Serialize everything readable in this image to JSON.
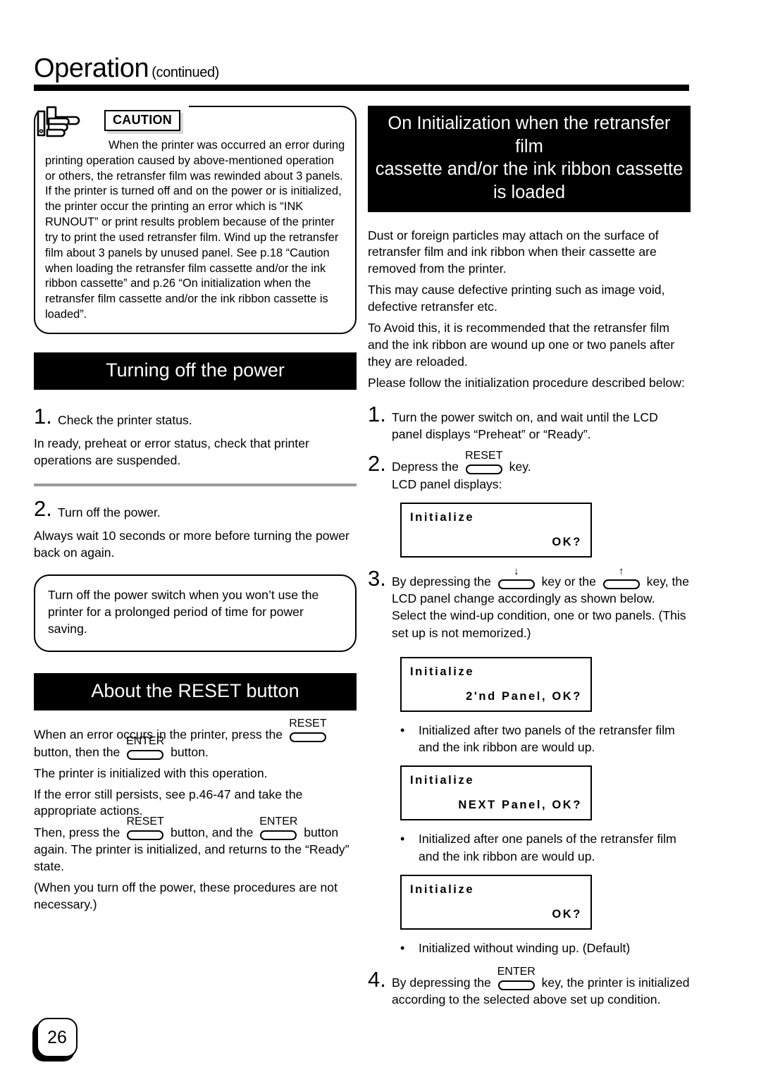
{
  "header": {
    "title": "Operation",
    "continued": "(continued)"
  },
  "caution": {
    "label": "CAUTION",
    "text": "When the printer was occurred an error during printing operation caused by above-mentioned operation or others, the retransfer film  was rewinded about 3 panels. If the printer is turned off and on the power or is initialized, the printer occur the printing an error which is “INK RUNOUT” or print results problem because of the printer try to print the used retransfer film. Wind up the retransfer film about 3 panels by unused panel. See p.18 “Caution when loading the retransfer film cassette and/or the ink ribbon cassette” and p.26 “On initialization when the retransfer film cassette and/or the ink ribbon cassette is loaded”."
  },
  "power_section": {
    "heading": "Turning off the power",
    "step1_num": "1.",
    "step1_title": "Check the printer status.",
    "step1_body": "In ready, preheat or error status, check that printer operations are suspended.",
    "step2_num": "2.",
    "step2_title": "Turn off the power.",
    "step2_body": "Always wait 10 seconds or more before turning the power back on again.",
    "note": "Turn off the power switch when you won’t use the printer for a prolonged period of time for power saving."
  },
  "reset_section": {
    "heading": "About the RESET button",
    "p1_a": "When an error occurs in the printer, press the",
    "p1_b": "button, then the",
    "p1_c": "button.",
    "p2": "The printer is initialized with this operation.",
    "p3": "If the error still persists, see p.46-47 and take the appropriate actions.",
    "p4_a": "Then, press the",
    "p4_b": "button, and the",
    "p4_c": "button again.  The printer is initialized, and returns to the “Ready” state.",
    "p5": "(When you turn off the power, these procedures are not necessary.)"
  },
  "init_section": {
    "heading_line1": "On Initialization when the retransfer film",
    "heading_line2": "cassette and/or the ink ribbon cassette",
    "heading_line3": "is loaded",
    "intro1": "Dust or foreign particles may attach on the surface of retransfer film and ink ribbon when their cassette are removed from the printer.",
    "intro2": "This may cause defective printing such as image void, defective retransfer etc.",
    "intro3": "To Avoid this, it is recommended that the retransfer film and the ink ribbon are wound up one or two panels after they are reloaded.",
    "intro4": "Please follow the initialization procedure described below:",
    "step1_num": "1.",
    "step1_text": "Turn the power switch on, and wait until the LCD panel displays “Preheat” or “Ready”.",
    "step2_num": "2.",
    "step2_a": "Depress  the",
    "step2_b": "key.",
    "step2_c": "LCD panel displays:",
    "step3_num": "3.",
    "step3_a": "By depressing the",
    "step3_b": "key or the",
    "step3_c": "key, the LCD panel change accordingly as shown below. Select the wind-up condition, one or two panels. (This set up is not memorized.)",
    "step4_num": "4.",
    "step4_a": "By depressing the",
    "step4_b": "key, the printer is initialized according to the selected above set up condition.",
    "lcd1": {
      "line1": "Initialize",
      "line2": "OK?"
    },
    "lcd2": {
      "line1": "Initialize",
      "line2": "2'nd Panel, OK?"
    },
    "lcd3": {
      "line1": "Initialize",
      "line2": "NEXT Panel, OK?"
    },
    "lcd4": {
      "line1": "Initialize",
      "line2": "OK?"
    },
    "bullet1": "Initialized after two panels of the retransfer film and the ink ribbon are would up.",
    "bullet2": "Initialized after one panels of the retransfer film and the ink ribbon are would up.",
    "bullet3": "Initialized without winding up. (Default)",
    "bullet_dot": "•"
  },
  "keys": {
    "reset": "RESET",
    "enter": "ENTER",
    "down": "↓",
    "up": "↑"
  },
  "page_number": "26",
  "colors": {
    "ink": "#000000",
    "divider": "#9a9a9a",
    "label_shadow": "#d9d9d9"
  }
}
